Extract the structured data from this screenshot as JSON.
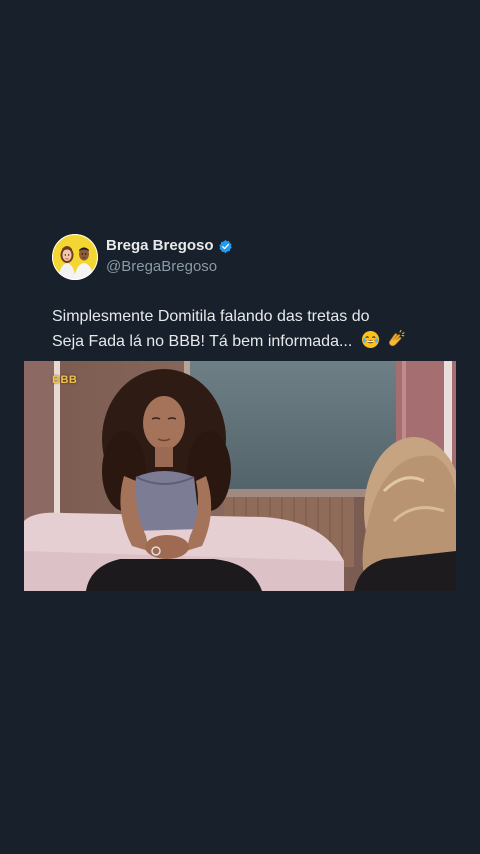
{
  "tweet": {
    "author": {
      "display_name": "Brega Bregoso",
      "handle": "@BregaBregoso",
      "verified": true,
      "avatar_icon": "avatar-illustration-icon"
    },
    "text_line1": "Simplesmente Domitila falando das tretas do",
    "text_line2": "Seja Fada lá no BBB! Tá bem informada...",
    "emojis": [
      "laughing-tears-emoji",
      "clapping-hands-emoji"
    ],
    "media": {
      "type": "video-still",
      "watermark": "BBB"
    }
  },
  "colors": {
    "background": "#17202b",
    "text_primary": "#e7e9ea",
    "text_secondary": "#8b98a5",
    "verified_badge": "#1d9bf0",
    "avatar_bg": "#f3d631"
  }
}
